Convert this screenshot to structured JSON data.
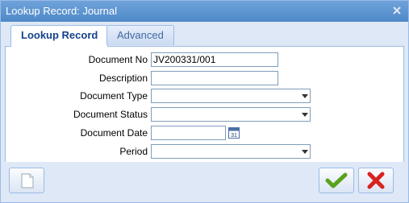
{
  "window": {
    "title": "Lookup Record: Journal"
  },
  "tabs": [
    {
      "label": "Lookup Record",
      "active": true
    },
    {
      "label": "Advanced",
      "active": false
    }
  ],
  "form": {
    "document_no": {
      "label": "Document No",
      "value": "JV200331/001"
    },
    "description": {
      "label": "Description",
      "value": ""
    },
    "document_type": {
      "label": "Document Type",
      "value": ""
    },
    "document_status": {
      "label": "Document Status",
      "value": ""
    },
    "document_date": {
      "label": "Document Date",
      "value": ""
    },
    "period": {
      "label": "Period",
      "value": ""
    }
  },
  "icons": {
    "close": "close-icon",
    "calendar": "calendar-icon",
    "new": "new-document-icon",
    "ok": "checkmark-icon",
    "cancel": "x-icon"
  },
  "colors": {
    "titlebar": "#5a92cf",
    "accent_green": "#5aa21e",
    "accent_red": "#d8231e"
  }
}
